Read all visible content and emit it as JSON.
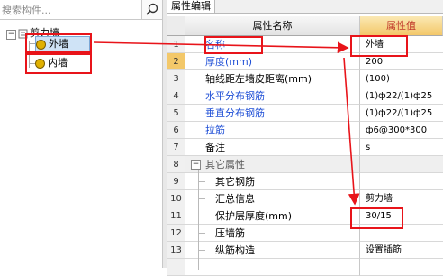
{
  "search": {
    "placeholder": "搜索构件..."
  },
  "tree": {
    "root": {
      "expander": "−",
      "label": "剪力墙"
    },
    "items": [
      {
        "label": "外墙"
      },
      {
        "label": "内墙"
      }
    ]
  },
  "panel": {
    "tab": "属性编辑"
  },
  "grid": {
    "header": {
      "name": "属性名称",
      "value": "属性值"
    },
    "rows": [
      {
        "num": "1",
        "name": "名称",
        "value": "外墙"
      },
      {
        "num": "2",
        "name": "厚度(mm)",
        "value": "200"
      },
      {
        "num": "3",
        "name": "轴线距左墙皮距离(mm)",
        "value": "(100)"
      },
      {
        "num": "4",
        "name": "水平分布钢筋",
        "value": "(1)ф22/(1)ф25"
      },
      {
        "num": "5",
        "name": "垂直分布钢筋",
        "value": "(1)ф22/(1)ф25"
      },
      {
        "num": "6",
        "name": "拉筋",
        "value": "ф6@300*300"
      },
      {
        "num": "7",
        "name": "备注",
        "value": "s"
      },
      {
        "num": "8",
        "name": "其它属性",
        "value": "",
        "expander": "−"
      },
      {
        "num": "9",
        "name": "其它钢筋",
        "value": ""
      },
      {
        "num": "10",
        "name": "汇总信息",
        "value": "剪力墙"
      },
      {
        "num": "11",
        "name": "保护层厚度(mm)",
        "value": "30/15"
      },
      {
        "num": "12",
        "name": "压墙筋",
        "value": ""
      },
      {
        "num": "13",
        "name": "纵筋构造",
        "value": "设置插筋"
      }
    ]
  },
  "colors": {
    "highlight": "#e8141a",
    "link_blue": "#1f4fd6",
    "header_accent": "#f3c86a"
  }
}
